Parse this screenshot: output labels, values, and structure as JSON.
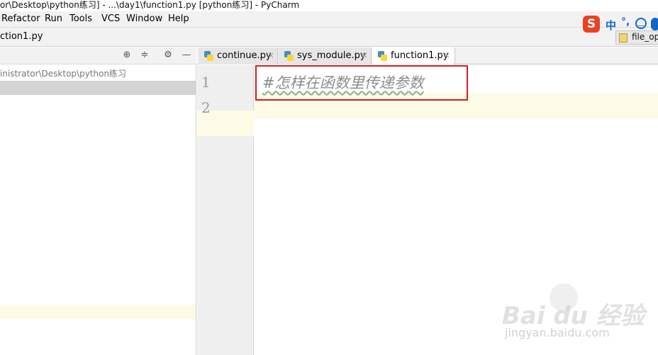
{
  "window": {
    "title": "or\\Desktop\\python练习] - ...\\day1\\function1.py [python练习] - PyCharm"
  },
  "menu": [
    "Refactor",
    "Run",
    "Tools",
    "VCS",
    "Window",
    "Help"
  ],
  "breadcrumb": {
    "file": "ction1.py"
  },
  "ime": {
    "logo": "S",
    "mode": "中",
    "punct": "°,"
  },
  "recent_tab": {
    "label": "file_op"
  },
  "project": {
    "path": "inistrator\\Desktop\\python练习"
  },
  "editor": {
    "tabs": [
      {
        "label": "continue.py",
        "close": "×",
        "active": false
      },
      {
        "label": "sys_module.py",
        "close": "×",
        "active": false
      },
      {
        "label": "function1.py",
        "close": "×",
        "active": true
      }
    ],
    "line_numbers": [
      "1",
      "2"
    ],
    "lines": [
      "#怎样在函数里传递参数",
      ""
    ]
  },
  "watermark": {
    "brand": "Bai du 经验",
    "url": "jingyan.baidu.com"
  }
}
